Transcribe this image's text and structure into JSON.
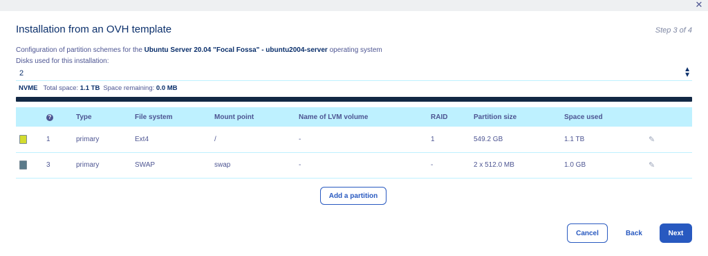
{
  "dialog": {
    "title": "Installation from an OVH template",
    "step": "Step 3 of 4",
    "close_icon": "close-icon"
  },
  "config": {
    "prefix": "Configuration of partition schemes for the ",
    "os_name": "Ubuntu Server 20.04 \"Focal Fossa\" - ubuntu2004-server",
    "suffix": " operating system",
    "disks_label": "Disks used for this installation:",
    "disks_value": "2"
  },
  "disk": {
    "type": "NVME",
    "total_label": "Total space: ",
    "total_value": "1.1 TB",
    "remaining_label": "Space remaining: ",
    "remaining_value": "0.0 MB",
    "bar_color": "#122844"
  },
  "table": {
    "headers": {
      "help": "?",
      "type": "Type",
      "fs": "File system",
      "mount": "Mount point",
      "lvm": "Name of LVM volume",
      "raid": "RAID",
      "size": "Partition size",
      "used": "Space used"
    },
    "rows": [
      {
        "color": "#d3dc2f",
        "num": "1",
        "type": "primary",
        "fs": "Ext4",
        "mount": "/",
        "lvm": "-",
        "raid": "1",
        "size": "549.2 GB",
        "used": "1.1 TB",
        "edit_icon": "pencil-icon"
      },
      {
        "color": "#5b7a8a",
        "num": "3",
        "type": "primary",
        "fs": "SWAP",
        "mount": "swap",
        "lvm": "-",
        "raid": "-",
        "size": "2 x 512.0 MB",
        "used": "1.0 GB",
        "edit_icon": "pencil-icon"
      }
    ]
  },
  "actions": {
    "add_partition": "Add a partition",
    "cancel": "Cancel",
    "back": "Back",
    "next": "Next"
  },
  "colors": {
    "accent": "#2859c0",
    "header_bg": "#bef1ff",
    "title": "#0a2f6b"
  }
}
